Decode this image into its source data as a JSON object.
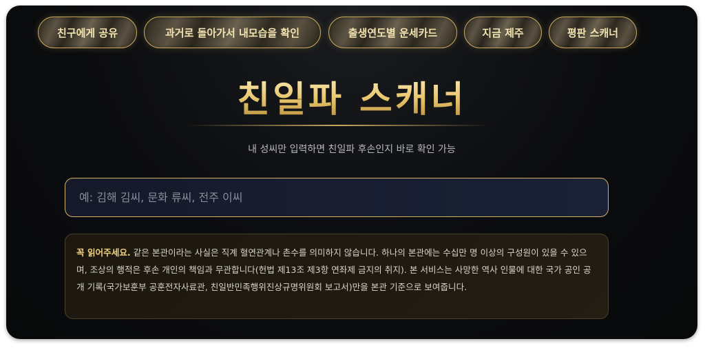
{
  "nav": {
    "items": [
      {
        "label": "친구에게 공유"
      },
      {
        "label": "과거로 돌아가서 내모습을 확인"
      },
      {
        "label": "출생연도별 운세카드"
      },
      {
        "label": "지금 제주"
      },
      {
        "label": "평판 스캐너"
      }
    ]
  },
  "header": {
    "title": "친일파 스캐너",
    "subtitle": "내 성씨만 입력하면 친일파 후손인지 바로 확인 가능"
  },
  "search": {
    "placeholder": "예: 김해 김씨, 문화 류씨, 전주 이씨",
    "value": ""
  },
  "notice": {
    "heading": "꼭 읽어주세요.",
    "body": " 같은 본관이라는 사실은 직계 혈연관계나 촌수를 의미하지 않습니다. 하나의 본관에는 수십만 명 이상의 구성원이 있을 수 있으며, 조상의 행적은 후손 개인의 책임과 무관합니다(헌법 제13조 제3항 연좌제 금지의 취지). 본 서비스는 사망한 역사 인물에 대한 국가 공인 공개 기록(국가보훈부 공훈전자사료관, 친일반민족행위진상규명위원회 보고서)만을 본관 기준으로 보여줍니다."
  },
  "colors": {
    "accent_gold": "#c9a860",
    "background": "#0b0c0e"
  }
}
